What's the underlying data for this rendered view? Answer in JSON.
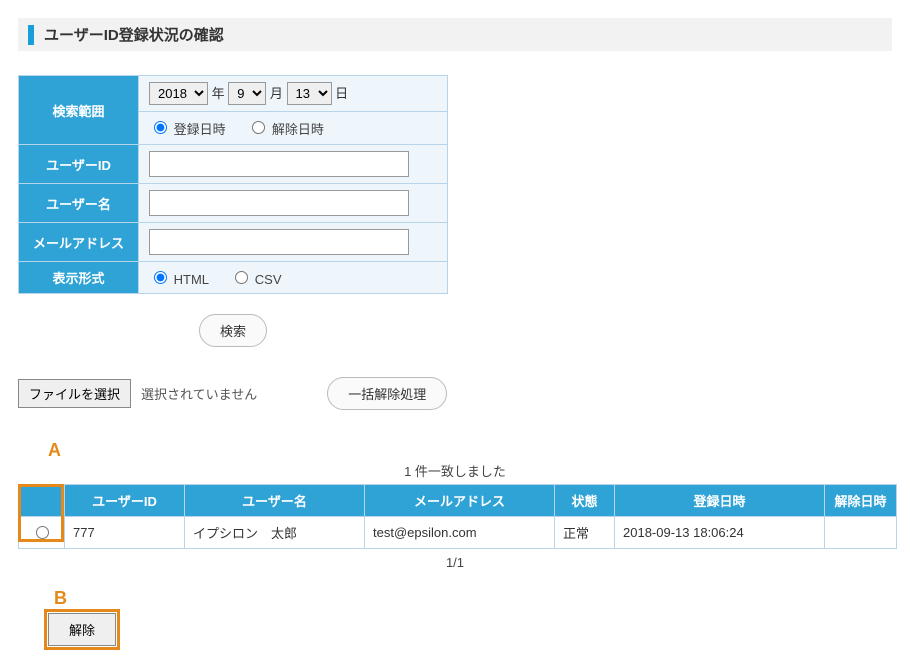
{
  "page": {
    "title": "ユーザーID登録状況の確認"
  },
  "search": {
    "range_label": "検索範囲",
    "year": "2018",
    "year_suffix": "年",
    "month": "9",
    "month_suffix": "月",
    "day": "13",
    "day_suffix": "日",
    "radio_reg": "登録日時",
    "radio_rel": "解除日時",
    "user_id_label": "ユーザーID",
    "user_name_label": "ユーザー名",
    "email_label": "メールアドレス",
    "format_label": "表示形式",
    "format_html": "HTML",
    "format_csv": "CSV",
    "submit": "検索"
  },
  "file": {
    "choose": "ファイルを選択",
    "status": "選択されていません",
    "bulk_release": "一括解除処理"
  },
  "results": {
    "hit": "1 件一致しました",
    "cols": {
      "user_id": "ユーザーID",
      "user_name": "ユーザー名",
      "email": "メールアドレス",
      "state": "状態",
      "reg_date": "登録日時",
      "rel_date": "解除日時"
    },
    "rows": [
      {
        "user_id": "777",
        "user_name": "イプシロン　太郎",
        "email": "test@epsilon.com",
        "state": "正常",
        "reg_date": "2018-09-13 18:06:24",
        "rel_date": ""
      }
    ],
    "pager": "1/1"
  },
  "markers": {
    "A": "A",
    "B": "B"
  },
  "actions": {
    "release": "解除"
  }
}
